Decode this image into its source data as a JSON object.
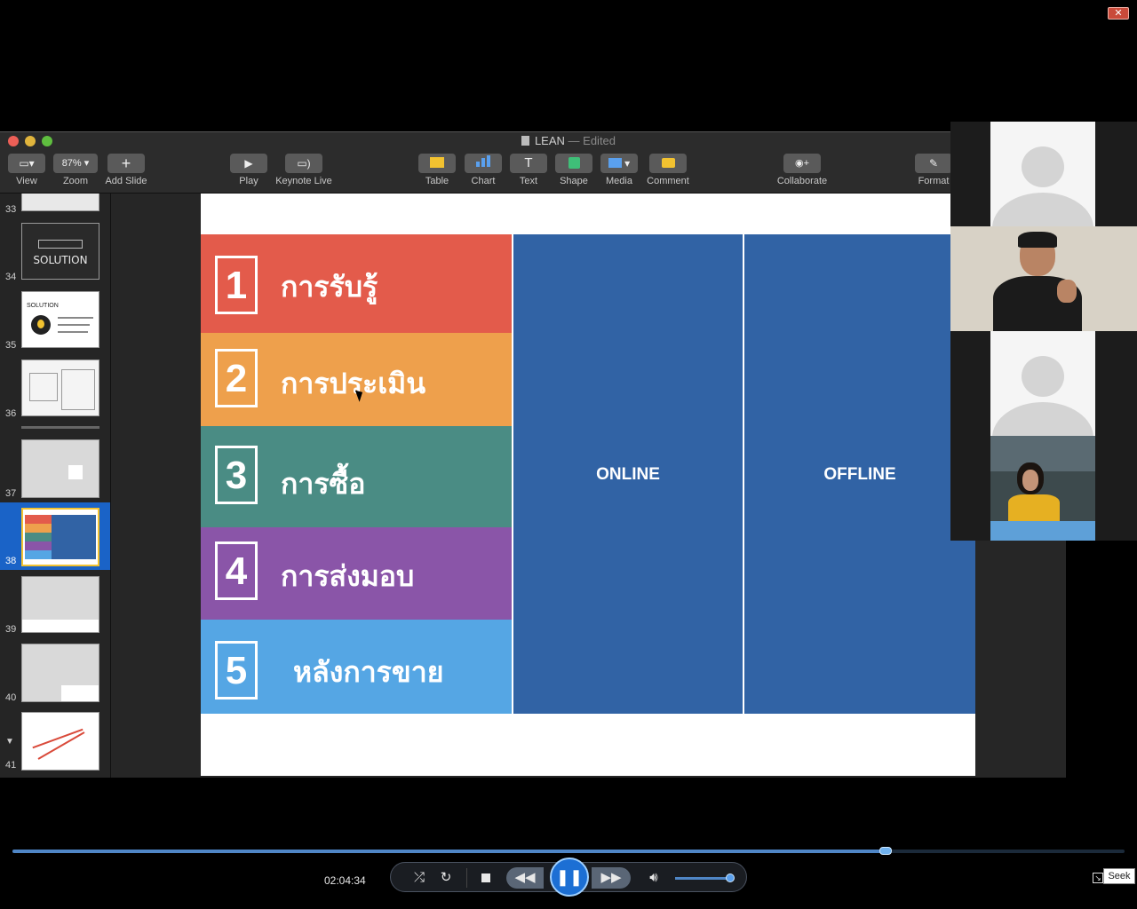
{
  "window": {
    "title": "LEAN",
    "edited": "— Edited"
  },
  "toolbar": {
    "zoom_value": "87%",
    "items": [
      {
        "label": "View",
        "icon": "sidebar-icon"
      },
      {
        "label": "Zoom",
        "icon": "zoom-icon"
      },
      {
        "label": "Add Slide",
        "icon": "plus-icon"
      },
      {
        "label": "Play",
        "icon": "play-icon"
      },
      {
        "label": "Keynote Live",
        "icon": "keynote-live-icon"
      },
      {
        "label": "Table",
        "icon": "table-icon"
      },
      {
        "label": "Chart",
        "icon": "chart-icon"
      },
      {
        "label": "Text",
        "icon": "text-icon"
      },
      {
        "label": "Shape",
        "icon": "shape-icon"
      },
      {
        "label": "Media",
        "icon": "media-icon"
      },
      {
        "label": "Comment",
        "icon": "comment-icon"
      },
      {
        "label": "Collaborate",
        "icon": "collaborate-icon"
      },
      {
        "label": "Format",
        "icon": "format-icon"
      }
    ]
  },
  "sidebar": {
    "slide_numbers": [
      "33",
      "34",
      "35",
      "36",
      "37",
      "38",
      "39",
      "40",
      "41"
    ],
    "selected": "38",
    "thumb34_text": "SOLUTION",
    "thumb35_text": "SOLUTION"
  },
  "slide": {
    "rows": [
      {
        "num": "1",
        "text": "การรับรู้",
        "color": "#e35b4b"
      },
      {
        "num": "2",
        "text": "การประเมิน",
        "color": "#eea04c"
      },
      {
        "num": "3",
        "text": "การซื้อ",
        "color": "#4a8c84"
      },
      {
        "num": "4",
        "text": "การส่งมอบ",
        "color": "#8a55a8"
      },
      {
        "num": "5",
        "text": "หลังการขาย",
        "color": "#55a6e4"
      }
    ],
    "columns": [
      {
        "label": "ONLINE"
      },
      {
        "label": "OFFLINE"
      }
    ],
    "column_color": "#3163a5"
  },
  "participants": [
    {
      "type": "avatar"
    },
    {
      "type": "video"
    },
    {
      "type": "avatar"
    },
    {
      "type": "video"
    }
  ],
  "player": {
    "timecode": "02:04:34",
    "progress": 0.785,
    "volume": 0.9,
    "seek_tooltip": "Seek",
    "controls": [
      "shuffle-icon",
      "repeat-icon",
      "stop-icon",
      "rewind-icon",
      "pause-icon",
      "forward-icon",
      "volume-icon"
    ]
  }
}
